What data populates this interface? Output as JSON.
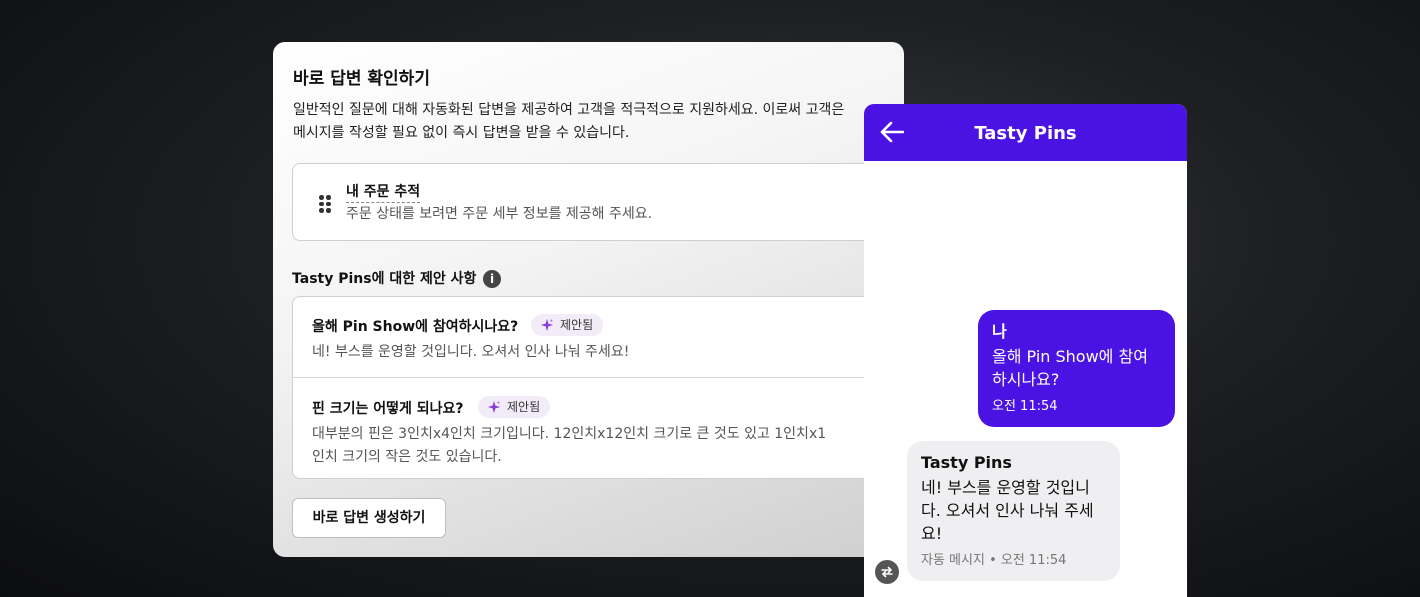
{
  "card": {
    "title": "바로 답변 확인하기",
    "description": "일반적인 질문에 대해 자동화된 답변을 제공하여 고객을 적극적으로 지원하세요. 이로써 고객은 메시지를 작성할 필요 없이 즉시 답변을 받을 수 있습니다.",
    "quick_reply": {
      "title": "내 주문 추적",
      "subtitle": "주문 상태를 보려면 주문 세부 정보를 제공해 주세요.",
      "icon": "drag-handle-icon"
    },
    "suggestions_title": "Tasty Pins에 대한 제안 사항",
    "suggestions": [
      {
        "question": "올해 Pin Show에 참여하시나요?",
        "badge": "제안됨",
        "answer": "네! 부스를 운영할 것입니다. 오셔서 인사 나눠 주세요!"
      },
      {
        "question": "핀 크기는 어떻게 되나요?",
        "badge": "제안됨",
        "answer": "대부분의 핀은 3인치x4인치 크기입니다. 12인치x12인치 크기로 큰 것도 있고 1인치x1인치 크기의 작은 것도 있습니다."
      }
    ],
    "generate_button": "바로 답변 생성하기"
  },
  "phone": {
    "title": "Tasty Pins",
    "header_color": "#4a13e3",
    "outgoing": {
      "sender": "나",
      "text": "올해 Pin Show에 참여하시나요?",
      "time": "오전 11:54"
    },
    "incoming": {
      "sender": "Tasty Pins",
      "text": "네! 부스를 운영할 것입니다. 오셔서 인사 나눠 주세요!",
      "time": "자동 메시지 • 오전 11:54"
    }
  }
}
